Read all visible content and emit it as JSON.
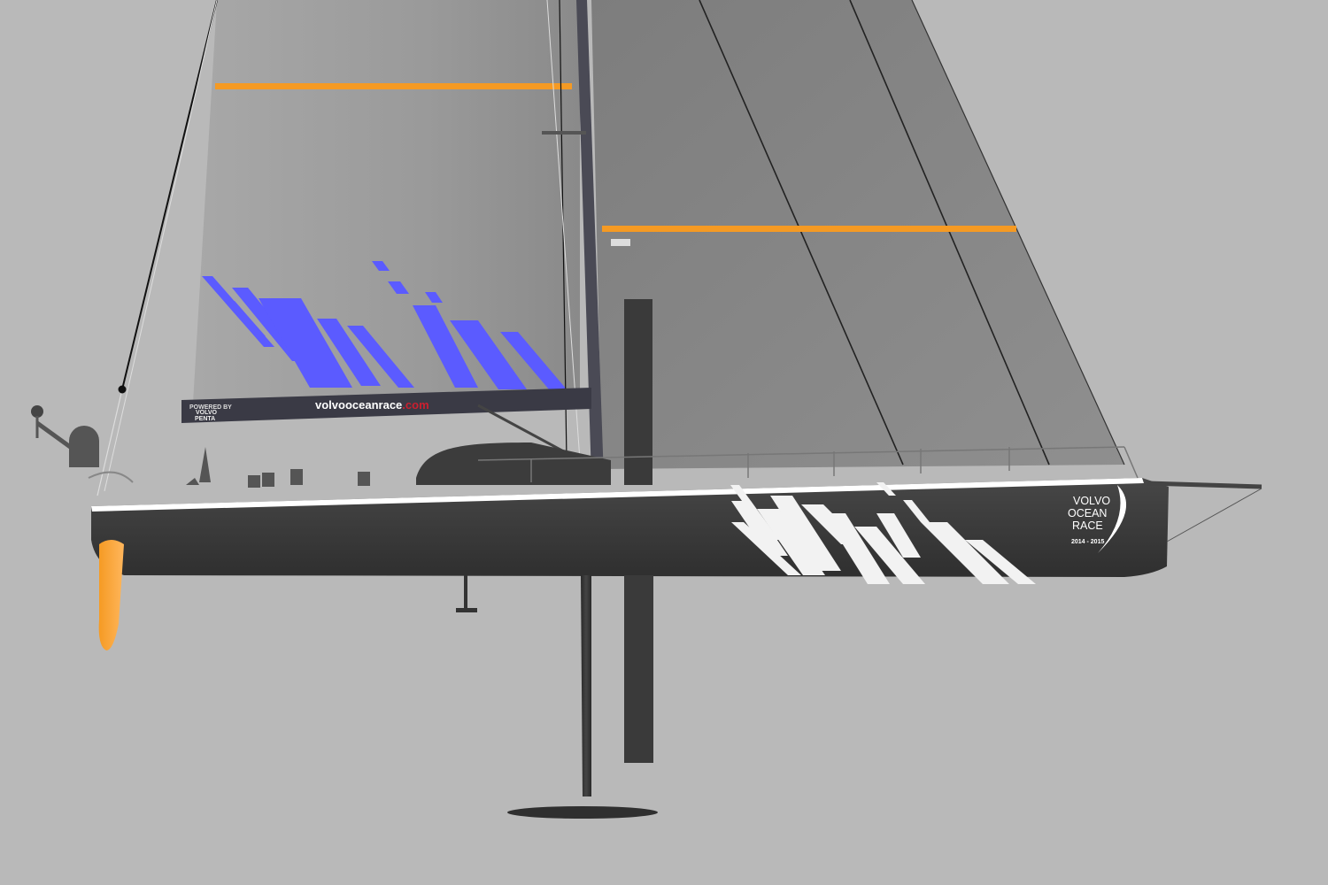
{
  "colors": {
    "background": "#b9b9b9",
    "hull": "#3a3a3a",
    "sail": "#8c8c8c",
    "sail_stripe": "#f59a23",
    "sail_graphic": "#5b5bff",
    "hull_graphic": "#f2f2f2",
    "rudder": "#f59a23",
    "web_accent": "#cc1f2f"
  },
  "boom": {
    "url_main": "volvooceanrace",
    "url_tld": ".com",
    "sponsor_small": "POWERED BY",
    "sponsor_line1": "VOLVO",
    "sponsor_line2": "PENTA"
  },
  "hull_logo": {
    "line1": "VOLVO",
    "line2": "OCEAN",
    "line3": "RACE",
    "years": "2014 - 2015"
  }
}
